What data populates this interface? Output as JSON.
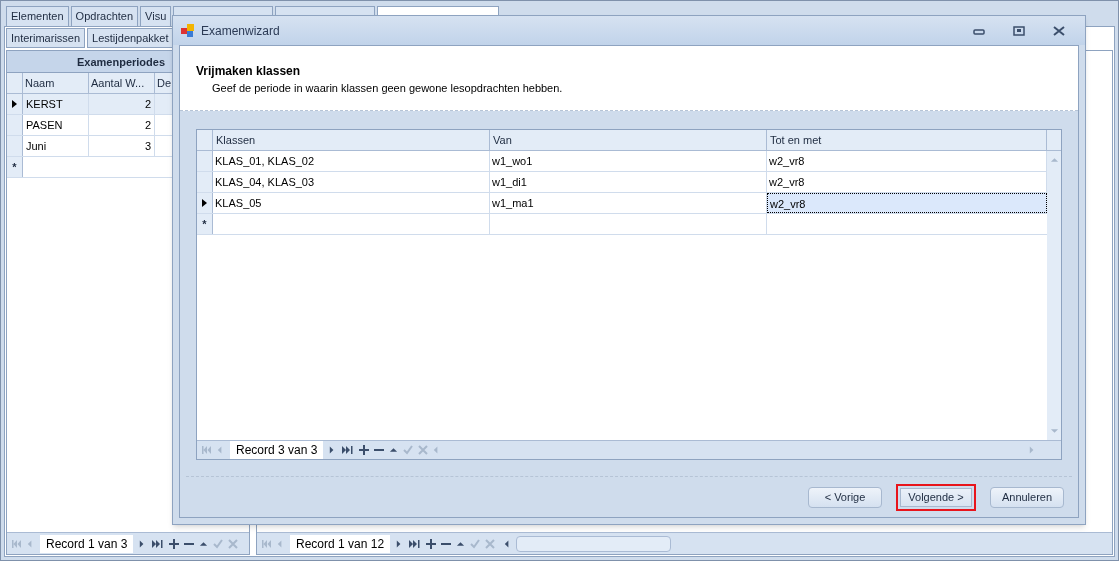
{
  "main_tabs": [
    {
      "label": "Elementen",
      "selected": false
    },
    {
      "label": "Opdrachten",
      "selected": false
    },
    {
      "label": "Visu",
      "selected": false
    },
    {
      "selected": false
    },
    {
      "selected": false
    },
    {
      "selected": true
    }
  ],
  "sub_tabs": [
    {
      "label": "Interimarissen",
      "selected": false
    },
    {
      "label": "Lestijdenpakket",
      "selected": false
    }
  ],
  "left_grid": {
    "title": "Examenperiodes",
    "columns": [
      "Naam",
      "Aantal W...",
      "De"
    ],
    "rows": [
      {
        "cells": [
          "KERST",
          "2"
        ],
        "selected": true
      },
      {
        "cells": [
          "PASEN",
          "2"
        ],
        "selected": false
      },
      {
        "cells": [
          "Juni",
          "3"
        ],
        "selected": false
      }
    ],
    "new_row_marker": "*",
    "navigator": "Record 1 van 3"
  },
  "right_navigator": "Record 1 van 12",
  "dialog": {
    "title": "Examenwizard",
    "heading": "Vrijmaken klassen",
    "description": "Geef de periode in waarin klassen geen gewone lesopdrachten hebben.",
    "grid": {
      "columns": [
        "Klassen",
        "Van",
        "Tot en met"
      ],
      "rows": [
        {
          "cells": [
            "KLAS_01, KLAS_02",
            "w1_wo1",
            "w2_vr8"
          ],
          "selected": false
        },
        {
          "cells": [
            "KLAS_04, KLAS_03",
            "w1_di1",
            "w2_vr8"
          ],
          "selected": false
        },
        {
          "cells": [
            "KLAS_05",
            "w1_ma1",
            "w2_vr8"
          ],
          "selected": true
        }
      ],
      "new_row_marker": "*",
      "navigator": "Record 3 van 3"
    },
    "buttons": [
      {
        "label": "< Vorige",
        "focused": false
      },
      {
        "label": "Volgende >",
        "focused": true
      },
      {
        "label": "Annuleren",
        "focused": false
      }
    ]
  }
}
